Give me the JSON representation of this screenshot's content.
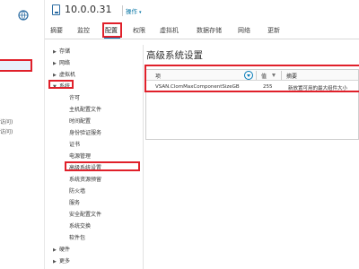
{
  "left_nav": {
    "text_1": "访问)",
    "text_2": "访问)"
  },
  "header": {
    "host": "10.0.0.31",
    "actions_label": "操作"
  },
  "tabs": [
    "摘要",
    "监控",
    "配置",
    "权限",
    "虚拟机",
    "数据存储",
    "网络",
    "更新"
  ],
  "tree": {
    "storage": "存储",
    "network": "网络",
    "vm": "虚拟机",
    "system": "系统",
    "system_children": [
      "许可",
      "主机配置文件",
      "时间配置",
      "身份验证服务",
      "证书",
      "电源管理",
      "高级系统设置",
      "系统资源预留",
      "防火墙",
      "服务",
      "安全配置文件",
      "系统交换",
      "软件包"
    ],
    "hardware": "硬件",
    "more": "更多"
  },
  "content": {
    "title": "高级系统设置",
    "columns": {
      "key": "项",
      "value": "值",
      "summary": "摘要"
    },
    "rows": [
      {
        "key": "VSAN.ClomMaxComponentSizeGB",
        "value": "255",
        "summary": "新放置可用的最大组件大小"
      }
    ]
  },
  "colors": {
    "accent": "#0079b8",
    "highlight": "#e0202a"
  }
}
